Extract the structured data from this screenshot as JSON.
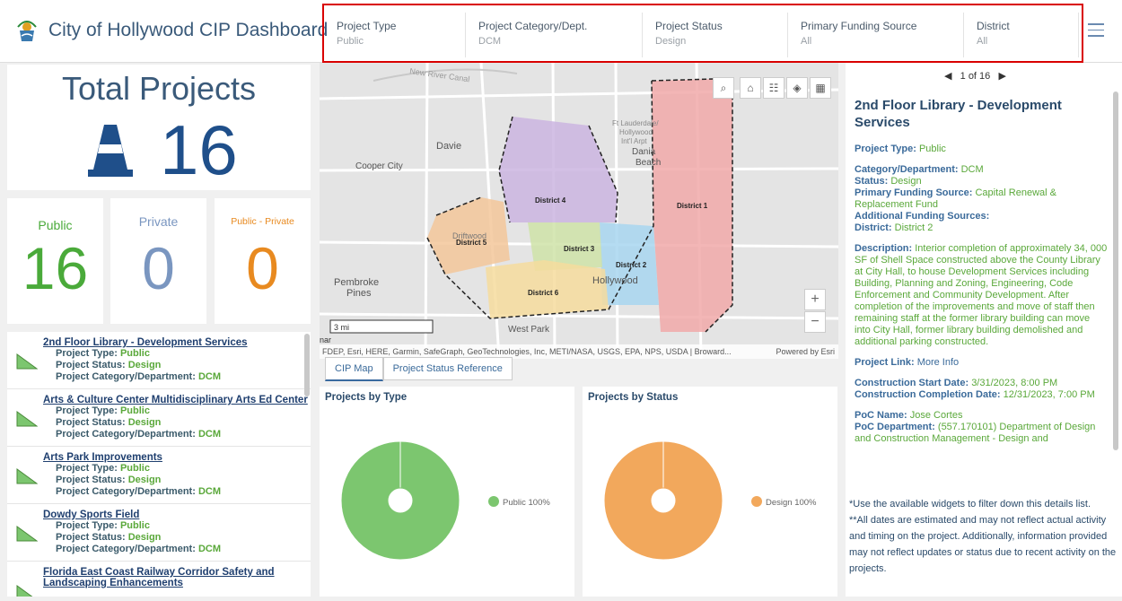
{
  "header": {
    "title": "City of Hollywood CIP Dashboard",
    "filters": [
      {
        "label": "Project Type",
        "value": "Public"
      },
      {
        "label": "Project Category/Dept.",
        "value": "DCM"
      },
      {
        "label": "Project Status",
        "value": "Design"
      },
      {
        "label": "Primary Funding Source",
        "value": "All"
      },
      {
        "label": "District",
        "value": "All"
      }
    ],
    "menu_icon": "hamburger-icon"
  },
  "total": {
    "title": "Total Projects",
    "count": "16",
    "icon": "traffic-cone-icon",
    "color": "#1f4f8a"
  },
  "stats": [
    {
      "label": "Public",
      "value": "16",
      "color": "#4aaa3a"
    },
    {
      "label": "Private",
      "value": "0",
      "color": "#7a96c0"
    },
    {
      "label": "Public - Private",
      "value": "0",
      "color": "#e88a20"
    }
  ],
  "list": {
    "field_labels": {
      "type": "Project Type:",
      "status": "Project Status:",
      "category": "Project Category/Department:"
    },
    "items": [
      {
        "title": "2nd Floor Library - Development Services",
        "type": "Public",
        "status": "Design",
        "category": "DCM"
      },
      {
        "title": "Arts & Culture Center Multidisciplinary Arts Ed Center",
        "type": "Public",
        "status": "Design",
        "category": "DCM"
      },
      {
        "title": "Arts Park Improvements",
        "type": "Public",
        "status": "Design",
        "category": "DCM"
      },
      {
        "title": "Dowdy Sports Field",
        "type": "Public",
        "status": "Design",
        "category": "DCM"
      },
      {
        "title": "Florida East Coast Railway Corridor Safety and",
        "title2": "Landscaping Enhancements"
      }
    ]
  },
  "map": {
    "labels": {
      "davie": "Davie",
      "cooper": "Cooper City",
      "dania": "Dania",
      "beach": "Beach",
      "pembroke": "Pembroke",
      "pines": "Pines",
      "hollywood": "Hollywood",
      "west_park": "West Park",
      "driftwood": "Driftwood",
      "river": "New River Canal",
      "ftl1": "Ft Lauderdale/",
      "ftl2": "Hollywood",
      "ftl3": "Int'l Arpt",
      "d1": "District 1",
      "d2": "District 2",
      "d3": "District 3",
      "d4": "District 4",
      "d5": "District 5",
      "d6": "District 6",
      "nar": "nar"
    },
    "scale": "3 mi",
    "attribution": "FDEP, Esri, HERE, Garmin, SafeGraph, GeoTechnologies, Inc, METI/NASA, USGS, EPA, NPS, USDA | Broward...",
    "powered_by": "Powered by Esri",
    "tools": [
      "search-icon",
      "home-icon",
      "legend-icon",
      "layers-icon",
      "basemap-icon"
    ],
    "tools_glyphs": [
      "⌕",
      "⌂",
      "☷",
      "◈",
      "▦"
    ],
    "zoom_in": "+",
    "zoom_out": "−"
  },
  "tabs": [
    {
      "label": "CIP Map",
      "active": true
    },
    {
      "label": "Project Status Reference",
      "active": false
    }
  ],
  "charts": {
    "type_title": "Projects by Type",
    "status_title": "Projects by Status"
  },
  "chart_data": [
    {
      "type": "pie",
      "title": "Projects by Type",
      "categories": [
        "Public"
      ],
      "values": [
        100
      ],
      "labels": [
        "Public 100%"
      ],
      "colors": [
        "#7cc66f"
      ]
    },
    {
      "type": "pie",
      "title": "Projects by Status",
      "categories": [
        "Design"
      ],
      "values": [
        100
      ],
      "labels": [
        "Design 100%"
      ],
      "colors": [
        "#f2a85c"
      ]
    }
  ],
  "detail": {
    "pager": "1 of 16",
    "title": "2nd Floor Library - Development Services",
    "project_type_label": "Project Type:",
    "project_type": "Public",
    "category_label": "Category/Department:",
    "category": "DCM",
    "status_label": "Status:",
    "status": "Design",
    "primary_funding_label": "Primary Funding Source:",
    "primary_funding": "Capital Renewal & Replacement Fund",
    "additional_funding_label": "Additional Funding Sources:",
    "district_label": "District:",
    "district": "District 2",
    "description_label": "Description:",
    "description": "Interior completion of approximately 34, 000 SF of Shell Space constructed above the County Library at City Hall, to house Development Services including Building, Planning and Zoning, Engineering, Code Enforcement and Community Development. After completion of the improvements and move of staff then remaining staff at the former library building can move into City Hall, former library building demolished and additional parking constructed.",
    "link_label": "Project Link:",
    "link": "More Info",
    "start_label": "Construction Start Date:",
    "start": "3/31/2023, 8:00 PM",
    "end_label": "Construction Completion Date:",
    "end": "12/31/2023, 7:00 PM",
    "poc_name_label": "PoC Name:",
    "poc_name": "Jose Cortes",
    "poc_dept_label": "PoC Department:",
    "poc_dept": "(557.170101) Department of Design and Construction Management - Design and"
  },
  "notes": {
    "line1": "*Use the available widgets to filter down this details list.",
    "line2": "**All dates are estimated and may not reflect actual activity and timing on the project. Additionally, information provided may not reflect updates or status due to recent activity on the projects."
  }
}
